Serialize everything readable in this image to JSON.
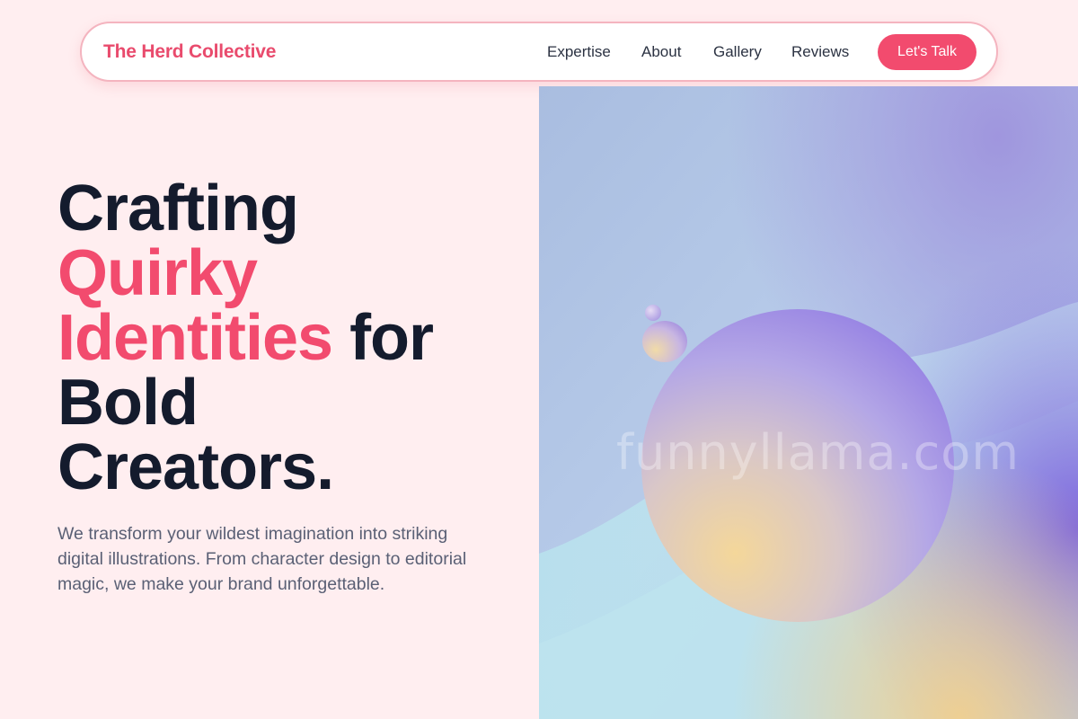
{
  "navbar": {
    "brand": "The Herd Collective",
    "links": [
      "Expertise",
      "About",
      "Gallery",
      "Reviews"
    ],
    "cta_label": "Let's Talk"
  },
  "hero": {
    "headline": {
      "line1": "Crafting",
      "accent1": "Quirky",
      "accent2": "Identities",
      "line3_rest": " for",
      "line4": "Bold",
      "line5": "Creators."
    },
    "subtext": "We transform your wildest imagination into striking digital illustrations. From character design to editorial magic, we make your brand unforgettable.",
    "image_watermark": "funnyllama.com"
  },
  "colors": {
    "page_background": "#ffeef0",
    "accent": "#f24b6e",
    "heading": "#141b2d",
    "body_text": "#5a6075",
    "nav_border": "#f4b4bf"
  }
}
